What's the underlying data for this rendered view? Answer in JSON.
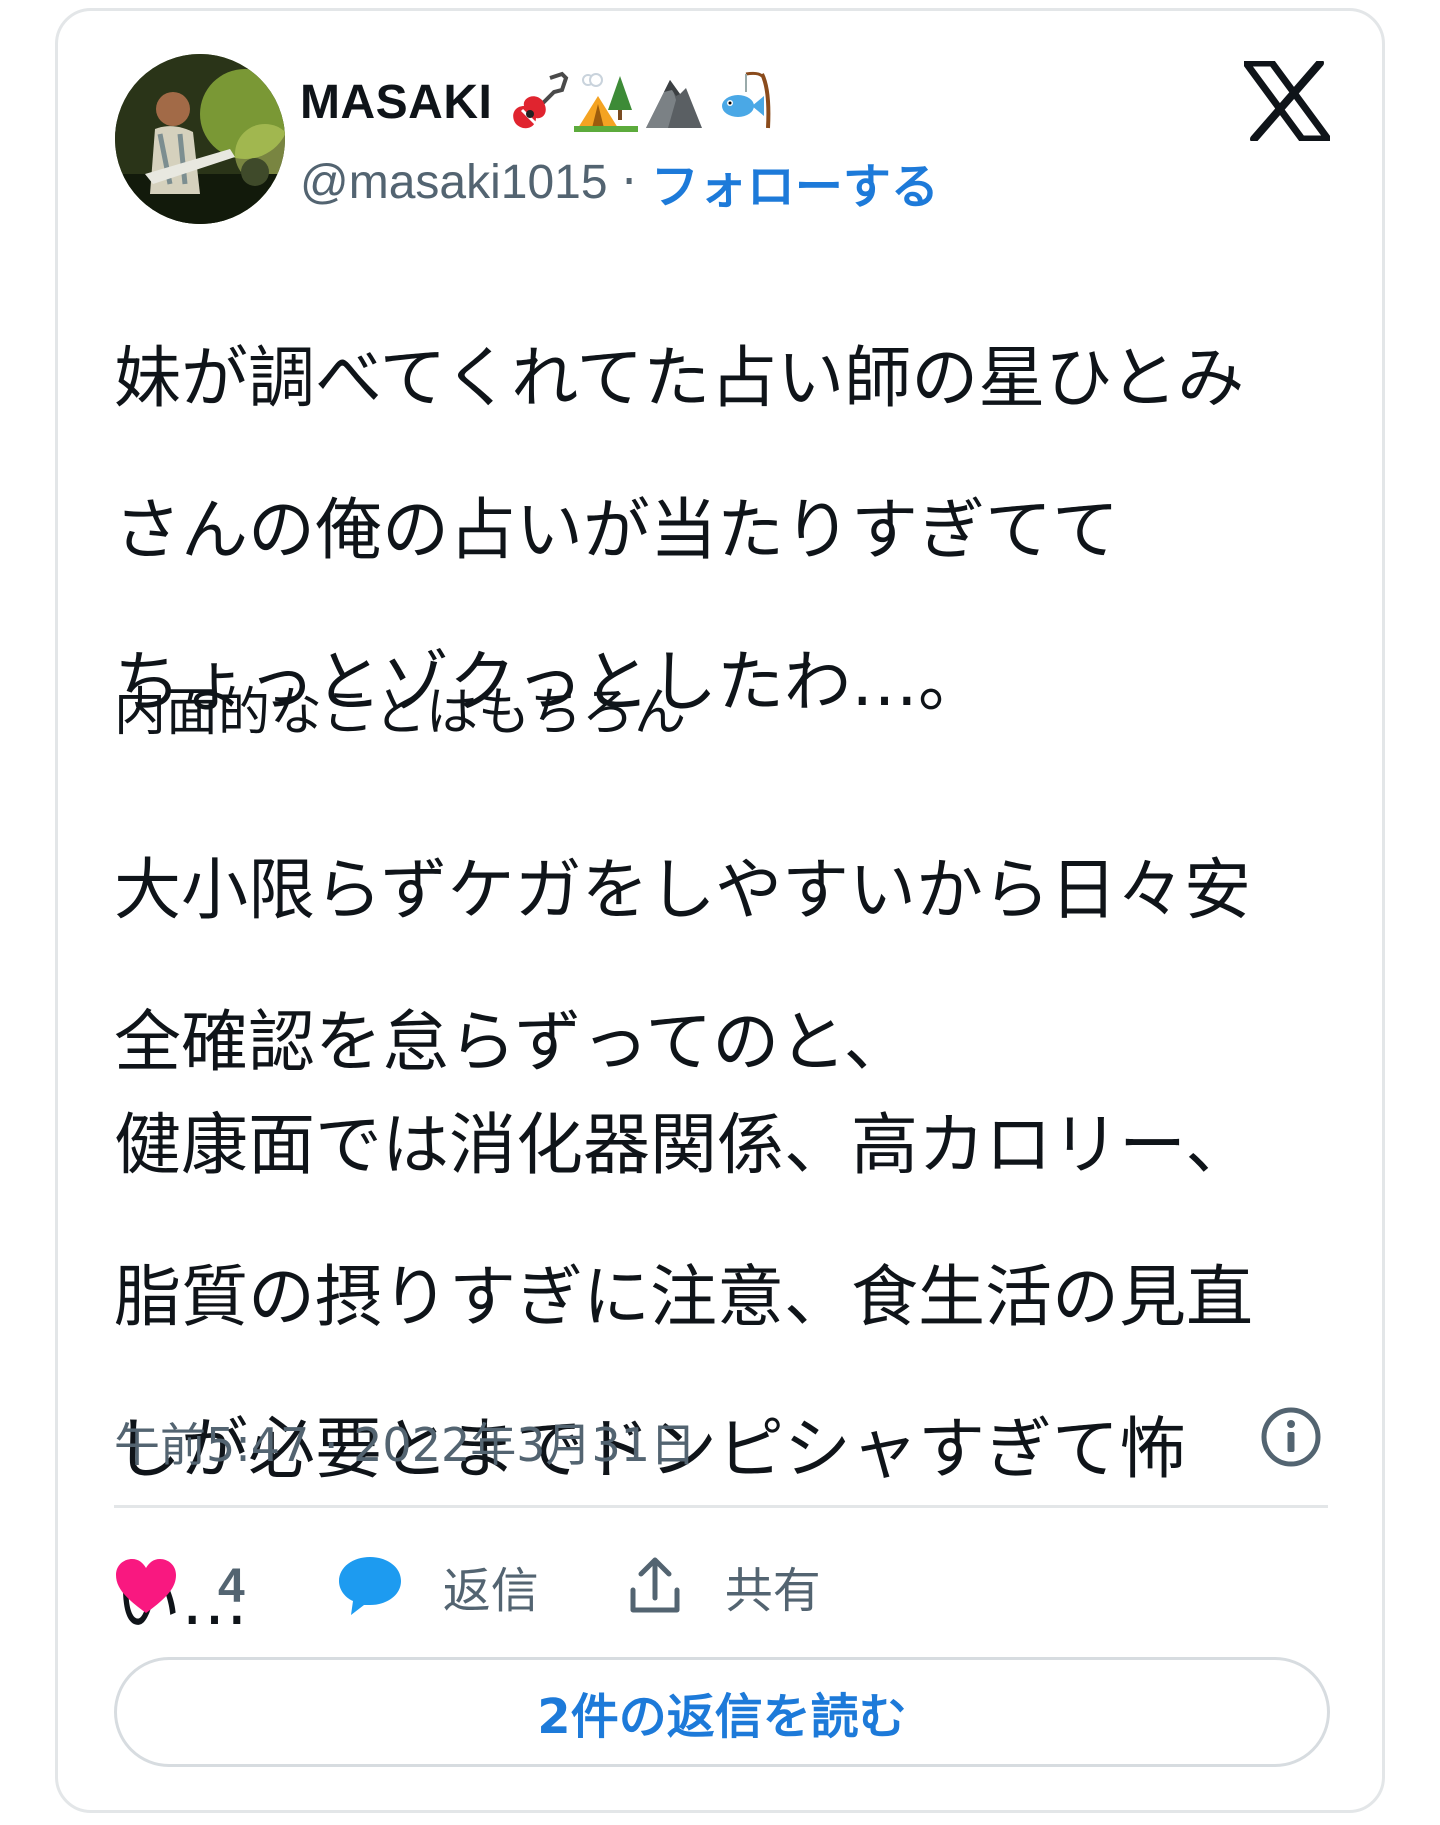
{
  "author": {
    "display_name": "MASAKI",
    "name_emojis": [
      "guitar-emoji",
      "camping-emoji",
      "mountain-emoji",
      "fishing-emoji"
    ],
    "handle": "@masaki1015",
    "separator": "·",
    "follow_label": "フォローする"
  },
  "tweet": {
    "para1": [
      "妹が調べてくれてた占い師の星ひとみ",
      "さんの俺の占いが当たりすぎてて",
      "ちょっとゾクっとしたわ…。"
    ],
    "para2": [
      "内面的なことはもちろん"
    ],
    "para3": [
      "大小限らずケガをしやすいから日々安",
      "全確認を怠らずってのと、"
    ],
    "para4": [
      "健康面では消化器関係、高カロリー、",
      "脂質の摂りすぎに注意、食生活の見直",
      "しが必要とまでドンピシャすぎて怖",
      "い…"
    ],
    "timestamp": "午前5:47 · 2022年3月31日"
  },
  "actions": {
    "like_count": "4",
    "reply_label": "返信",
    "share_label": "共有"
  },
  "read_replies_label": "2件の返信を読む",
  "colors": {
    "like": "#f91880",
    "reply": "#1d9bf0",
    "link": "#1d7ad9",
    "secondary_text": "#536471"
  }
}
